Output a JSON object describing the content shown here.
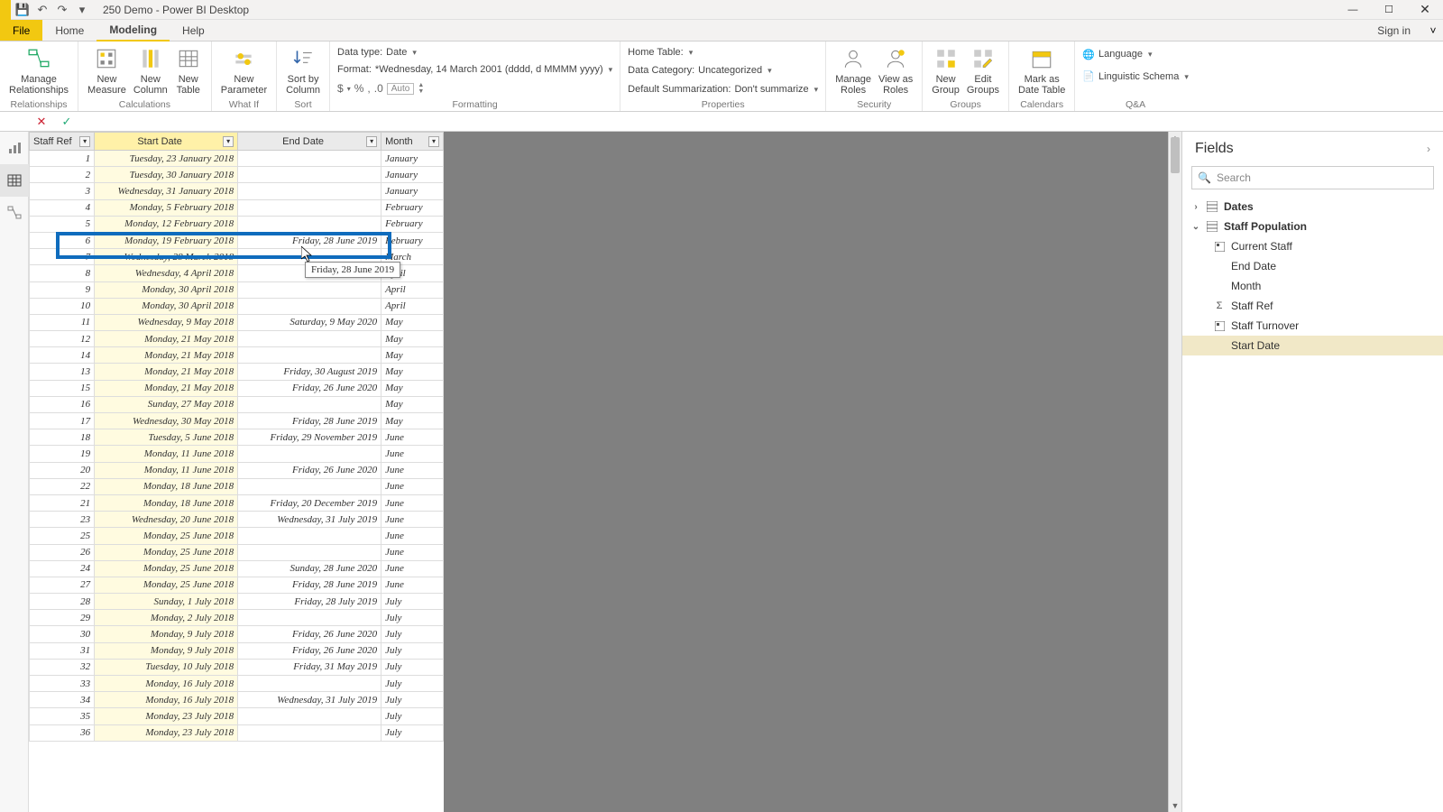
{
  "title": "250 Demo - Power BI Desktop",
  "qat": {
    "save": "💾",
    "undo": "↶",
    "redo": "↷"
  },
  "window_controls": {
    "min": "—",
    "max": "☐",
    "close": "✕"
  },
  "menu": {
    "file": "File",
    "tabs": [
      "Home",
      "Modeling",
      "Help"
    ],
    "active_tab": "Modeling",
    "signin": "Sign in",
    "caret": "˅"
  },
  "ribbon": {
    "relationships": {
      "manage": "Manage\nRelationships",
      "group": "Relationships"
    },
    "calculations": {
      "new_measure": "New\nMeasure",
      "new_column": "New\nColumn",
      "new_table": "New\nTable",
      "group": "Calculations"
    },
    "whatif": {
      "new_param": "New\nParameter",
      "group": "What If"
    },
    "sort": {
      "sort_by": "Sort by\nColumn",
      "group": "Sort"
    },
    "formatting": {
      "data_type_label": "Data type:",
      "data_type_value": "Date",
      "format_label": "Format:",
      "format_value": "*Wednesday, 14 March 2001 (dddd, d MMMM yyyy)",
      "currency": "$",
      "percent": "%",
      "comma": ",",
      "decimals": ".0",
      "auto": "Auto",
      "group": "Formatting"
    },
    "properties": {
      "home_table_label": "Home Table:",
      "data_category_label": "Data Category:",
      "data_category_value": "Uncategorized",
      "default_summarization_label": "Default Summarization:",
      "default_summarization_value": "Don't summarize",
      "group": "Properties"
    },
    "security": {
      "manage_roles": "Manage\nRoles",
      "view_as_roles": "View as\nRoles",
      "group": "Security"
    },
    "groups": {
      "new_group": "New\nGroup",
      "edit_groups": "Edit\nGroups",
      "group": "Groups"
    },
    "calendars": {
      "mark_date_table": "Mark as\nDate Table",
      "group": "Calendars"
    },
    "qa": {
      "language": "Language",
      "linguistic": "Linguistic Schema",
      "group": "Q&A"
    }
  },
  "formula_bar": {
    "cancel": "✕",
    "accept": "✓"
  },
  "table": {
    "headers": {
      "staff_ref": "Staff Ref",
      "start_date": "Start Date",
      "end_date": "End Date",
      "month": "Month"
    },
    "selected_column": "start_date",
    "rows": [
      {
        "ref": "1",
        "start": "Tuesday, 23 January 2018",
        "end": "",
        "month": "January"
      },
      {
        "ref": "2",
        "start": "Tuesday, 30 January 2018",
        "end": "",
        "month": "January"
      },
      {
        "ref": "3",
        "start": "Wednesday, 31 January 2018",
        "end": "",
        "month": "January"
      },
      {
        "ref": "4",
        "start": "Monday, 5 February 2018",
        "end": "",
        "month": "February"
      },
      {
        "ref": "5",
        "start": "Monday, 12 February 2018",
        "end": "",
        "month": "February"
      },
      {
        "ref": "6",
        "start": "Monday, 19 February 2018",
        "end": "Friday, 28 June 2019",
        "month": "February"
      },
      {
        "ref": "7",
        "start": "Wednesday, 28 March 2018",
        "end": "",
        "month": "March"
      },
      {
        "ref": "8",
        "start": "Wednesday, 4 April 2018",
        "end": "",
        "month": "April"
      },
      {
        "ref": "9",
        "start": "Monday, 30 April 2018",
        "end": "",
        "month": "April"
      },
      {
        "ref": "10",
        "start": "Monday, 30 April 2018",
        "end": "",
        "month": "April"
      },
      {
        "ref": "11",
        "start": "Wednesday, 9 May 2018",
        "end": "Saturday, 9 May 2020",
        "month": "May"
      },
      {
        "ref": "12",
        "start": "Monday, 21 May 2018",
        "end": "",
        "month": "May"
      },
      {
        "ref": "14",
        "start": "Monday, 21 May 2018",
        "end": "",
        "month": "May"
      },
      {
        "ref": "13",
        "start": "Monday, 21 May 2018",
        "end": "Friday, 30 August 2019",
        "month": "May"
      },
      {
        "ref": "15",
        "start": "Monday, 21 May 2018",
        "end": "Friday, 26 June 2020",
        "month": "May"
      },
      {
        "ref": "16",
        "start": "Sunday, 27 May 2018",
        "end": "",
        "month": "May"
      },
      {
        "ref": "17",
        "start": "Wednesday, 30 May 2018",
        "end": "Friday, 28 June 2019",
        "month": "May"
      },
      {
        "ref": "18",
        "start": "Tuesday, 5 June 2018",
        "end": "Friday, 29 November 2019",
        "month": "June"
      },
      {
        "ref": "19",
        "start": "Monday, 11 June 2018",
        "end": "",
        "month": "June"
      },
      {
        "ref": "20",
        "start": "Monday, 11 June 2018",
        "end": "Friday, 26 June 2020",
        "month": "June"
      },
      {
        "ref": "22",
        "start": "Monday, 18 June 2018",
        "end": "",
        "month": "June"
      },
      {
        "ref": "21",
        "start": "Monday, 18 June 2018",
        "end": "Friday, 20 December 2019",
        "month": "June"
      },
      {
        "ref": "23",
        "start": "Wednesday, 20 June 2018",
        "end": "Wednesday, 31 July 2019",
        "month": "June"
      },
      {
        "ref": "25",
        "start": "Monday, 25 June 2018",
        "end": "",
        "month": "June"
      },
      {
        "ref": "26",
        "start": "Monday, 25 June 2018",
        "end": "",
        "month": "June"
      },
      {
        "ref": "24",
        "start": "Monday, 25 June 2018",
        "end": "Sunday, 28 June 2020",
        "month": "June"
      },
      {
        "ref": "27",
        "start": "Monday, 25 June 2018",
        "end": "Friday, 28 June 2019",
        "month": "June"
      },
      {
        "ref": "28",
        "start": "Sunday, 1 July 2018",
        "end": "Friday, 28 July 2019",
        "month": "July"
      },
      {
        "ref": "29",
        "start": "Monday, 2 July 2018",
        "end": "",
        "month": "July"
      },
      {
        "ref": "30",
        "start": "Monday, 9 July 2018",
        "end": "Friday, 26 June 2020",
        "month": "July"
      },
      {
        "ref": "31",
        "start": "Monday, 9 July 2018",
        "end": "Friday, 26 June 2020",
        "month": "July"
      },
      {
        "ref": "32",
        "start": "Tuesday, 10 July 2018",
        "end": "Friday, 31 May 2019",
        "month": "July"
      },
      {
        "ref": "33",
        "start": "Monday, 16 July 2018",
        "end": "",
        "month": "July"
      },
      {
        "ref": "34",
        "start": "Monday, 16 July 2018",
        "end": "Wednesday, 31 July 2019",
        "month": "July"
      },
      {
        "ref": "35",
        "start": "Monday, 23 July 2018",
        "end": "",
        "month": "July"
      },
      {
        "ref": "36",
        "start": "Monday, 23 July 2018",
        "end": "",
        "month": "July"
      }
    ],
    "highlight_row_index": 5,
    "tooltip": "Friday, 28 June 2019"
  },
  "fields": {
    "title": "Fields",
    "search_placeholder": "Search",
    "tables": [
      {
        "name": "Dates",
        "expanded": false
      },
      {
        "name": "Staff Population",
        "expanded": true,
        "columns": [
          {
            "name": "Current Staff",
            "icon": "measure"
          },
          {
            "name": "End Date",
            "icon": ""
          },
          {
            "name": "Month",
            "icon": ""
          },
          {
            "name": "Staff Ref",
            "icon": "sigma"
          },
          {
            "name": "Staff Turnover",
            "icon": "measure"
          },
          {
            "name": "Start Date",
            "icon": "",
            "selected": true
          }
        ]
      }
    ]
  }
}
